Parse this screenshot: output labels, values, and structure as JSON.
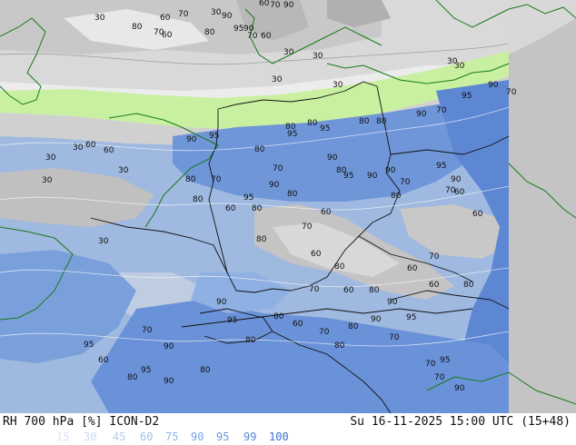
{
  "header": {
    "product_label": "RH 700 hPa [%] ICON-D2",
    "valid_time": "Su 16-11-2025 15:00 UTC (15+48)"
  },
  "legend": {
    "items": [
      {
        "label": "15",
        "color": "#d9e6f5"
      },
      {
        "label": "30",
        "color": "#c9dbef"
      },
      {
        "label": "45",
        "color": "#b7cfe9"
      },
      {
        "label": "60",
        "color": "#9ec0e6"
      },
      {
        "label": "75",
        "color": "#8eb4e6"
      },
      {
        "label": "90",
        "color": "#7aa5e6"
      },
      {
        "label": "95",
        "color": "#6b95dc"
      },
      {
        "label": "99",
        "color": "#5b87d6"
      },
      {
        "label": "100",
        "color": "#3f6fd0"
      }
    ]
  },
  "map": {
    "colors": {
      "out_of_domain": "#c4c4c4",
      "low_rh": "#ececec",
      "mid_rh": "#d7d7d7",
      "high_rh": "#b5b5b5",
      "very_dry_band": "#c8f0a0",
      "moist": "#7aa5e6",
      "saturated": "#5b87d6",
      "coastline": "#1a7a1a",
      "border": "#111111"
    },
    "contour_labels": [
      {
        "text": "30"
      },
      {
        "text": "60"
      },
      {
        "text": "70"
      },
      {
        "text": "30"
      },
      {
        "text": "90"
      },
      {
        "text": "60"
      },
      {
        "text": "70"
      },
      {
        "text": "90"
      },
      {
        "text": "80"
      },
      {
        "text": "70"
      },
      {
        "text": "60"
      },
      {
        "text": "80"
      },
      {
        "text": "95"
      },
      {
        "text": "90"
      },
      {
        "text": "70"
      },
      {
        "text": "60"
      },
      {
        "text": "30"
      },
      {
        "text": "30"
      },
      {
        "text": "30"
      },
      {
        "text": "30"
      },
      {
        "text": "30"
      },
      {
        "text": "30"
      },
      {
        "text": "30"
      },
      {
        "text": "90"
      },
      {
        "text": "70"
      },
      {
        "text": "80"
      },
      {
        "text": "95"
      },
      {
        "text": "90"
      },
      {
        "text": "70"
      },
      {
        "text": "80"
      },
      {
        "text": "95"
      },
      {
        "text": "80"
      },
      {
        "text": "80"
      },
      {
        "text": "95"
      },
      {
        "text": "90"
      },
      {
        "text": "80"
      },
      {
        "text": "60"
      },
      {
        "text": "30"
      },
      {
        "text": "60"
      },
      {
        "text": "30"
      },
      {
        "text": "30"
      },
      {
        "text": "70"
      },
      {
        "text": "60"
      },
      {
        "text": "30"
      },
      {
        "text": "80"
      },
      {
        "text": "95"
      },
      {
        "text": "90"
      },
      {
        "text": "80"
      },
      {
        "text": "90"
      },
      {
        "text": "95"
      },
      {
        "text": "70"
      },
      {
        "text": "60"
      },
      {
        "text": "80"
      },
      {
        "text": "95"
      },
      {
        "text": "80"
      },
      {
        "text": "90"
      },
      {
        "text": "70"
      },
      {
        "text": "80"
      },
      {
        "text": "60"
      },
      {
        "text": "95"
      },
      {
        "text": "90"
      },
      {
        "text": "80"
      },
      {
        "text": "70"
      },
      {
        "text": "90"
      },
      {
        "text": "60"
      },
      {
        "text": "80"
      },
      {
        "text": "70"
      },
      {
        "text": "60"
      },
      {
        "text": "80"
      },
      {
        "text": "60"
      },
      {
        "text": "70"
      },
      {
        "text": "60"
      },
      {
        "text": "80"
      },
      {
        "text": "70"
      },
      {
        "text": "60"
      },
      {
        "text": "80"
      },
      {
        "text": "90"
      },
      {
        "text": "95"
      },
      {
        "text": "90"
      },
      {
        "text": "80"
      },
      {
        "text": "70"
      },
      {
        "text": "60"
      },
      {
        "text": "80"
      },
      {
        "text": "70"
      },
      {
        "text": "90"
      },
      {
        "text": "95"
      },
      {
        "text": "80"
      },
      {
        "text": "90"
      },
      {
        "text": "70"
      },
      {
        "text": "60"
      },
      {
        "text": "80"
      },
      {
        "text": "95"
      },
      {
        "text": "90"
      },
      {
        "text": "80"
      },
      {
        "text": "70"
      },
      {
        "text": "95"
      },
      {
        "text": "90"
      },
      {
        "text": "80"
      },
      {
        "text": "70"
      },
      {
        "text": "95"
      }
    ]
  }
}
